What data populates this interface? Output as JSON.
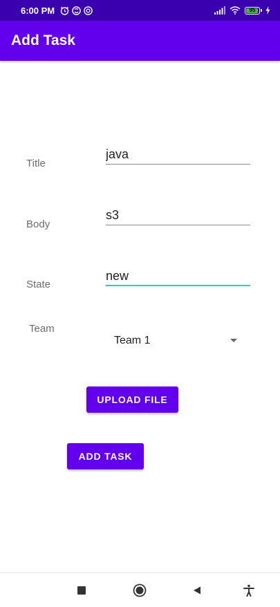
{
  "status_bar": {
    "time": "6:00 PM",
    "battery_level": "95",
    "icons": [
      "alarm-icon",
      "sync-icon",
      "data-saver-icon",
      "signal-icon",
      "wifi-icon",
      "battery-icon",
      "charging-icon"
    ]
  },
  "app_bar": {
    "title": "Add Task"
  },
  "form": {
    "title_label": "Title",
    "title_value": "java",
    "body_label": "Body",
    "body_value": "s3",
    "state_label": "State",
    "state_value": "new",
    "team_label": "Team",
    "team_selected": "Team 1"
  },
  "buttons": {
    "upload_label": "UPLOAD FILE",
    "add_label": "ADD TASK"
  },
  "nav_bar": {
    "icons": [
      "recents-square-icon",
      "home-circle-icon",
      "back-triangle-icon",
      "accessibility-icon"
    ]
  },
  "colors": {
    "status_bar": "#3a00b0",
    "primary": "#6200ee",
    "accent": "#03dac5",
    "battery": "#4caf50"
  }
}
